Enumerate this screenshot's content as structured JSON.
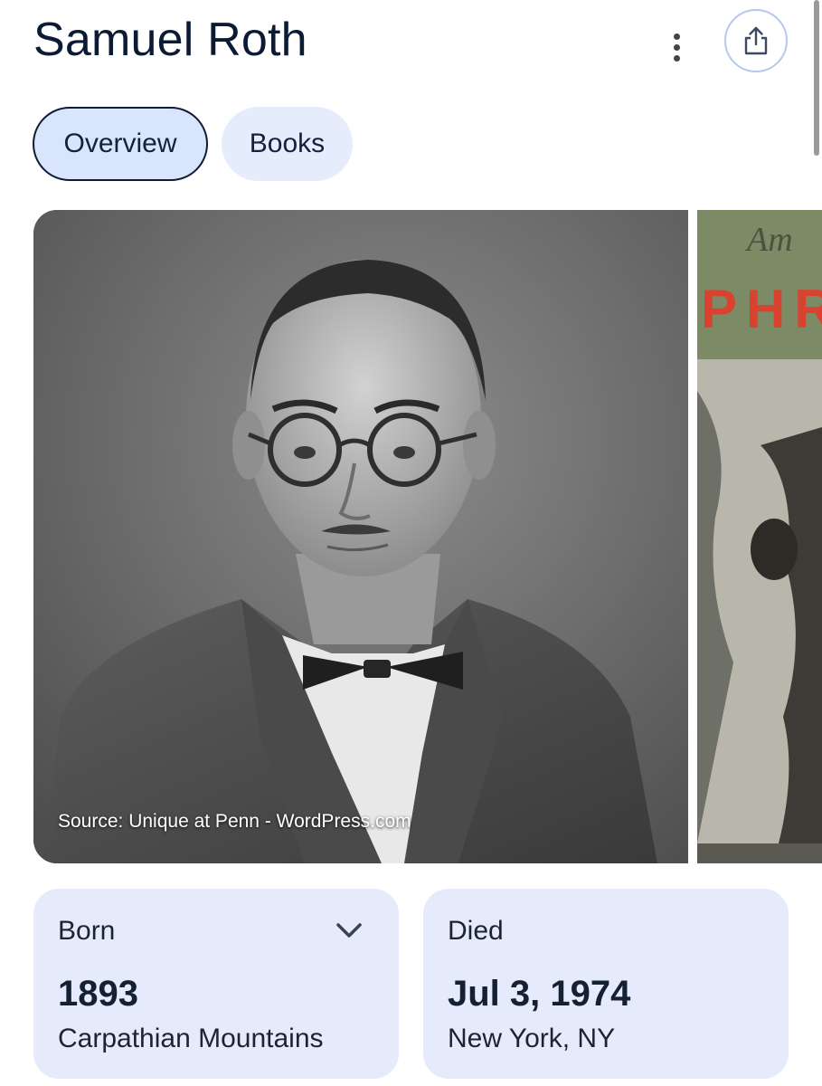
{
  "header": {
    "title": "Samuel Roth"
  },
  "icons": {
    "more": "more-vert-icon",
    "share": "share-icon",
    "expand": "chevron-down-icon"
  },
  "tabs": [
    {
      "label": "Overview",
      "selected": true
    },
    {
      "label": "Books",
      "selected": false
    }
  ],
  "images": {
    "main_source": "Source: Unique at Penn - WordPress.com",
    "side_partial_text": "PHR",
    "side_partial_top": "Am"
  },
  "facts": {
    "born": {
      "label": "Born",
      "year": "1893",
      "place": "Carpathian Mountains"
    },
    "died": {
      "label": "Died",
      "date": "Jul 3, 1974",
      "place": "New York, NY"
    }
  },
  "colors": {
    "chip_selected": "#d9e5fc",
    "chip": "#e5ecfb",
    "card_bg": "#e5ebfb",
    "title": "#0b1b33"
  }
}
